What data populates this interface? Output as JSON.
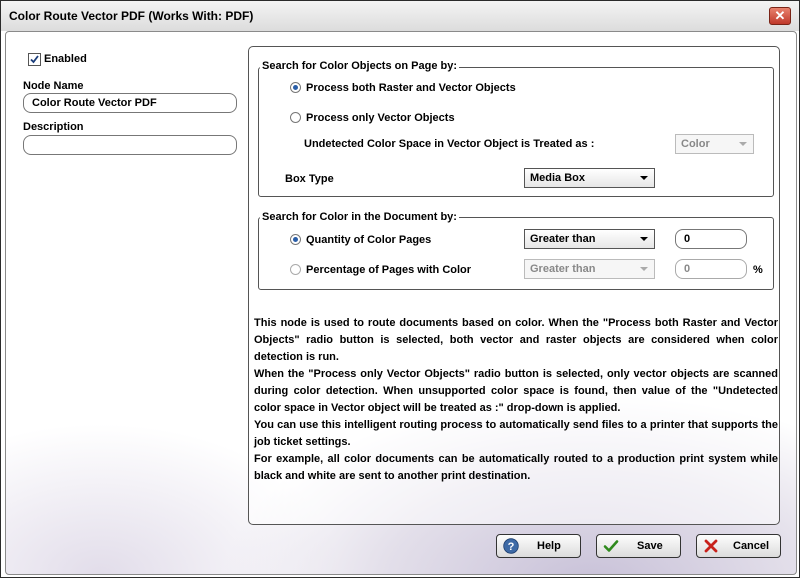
{
  "window": {
    "title": "Color Route Vector PDF  (Works With: PDF)",
    "close_label": "✕"
  },
  "left": {
    "enabled_label": "Enabled",
    "enabled_checked": true,
    "node_name_label": "Node Name",
    "node_name_value": "Color Route Vector PDF",
    "description_label": "Description",
    "description_value": ""
  },
  "objects_group": {
    "legend": "Search for Color Objects on Page by:",
    "option_both": "Process both Raster and Vector Objects",
    "option_vector": "Process only Vector Objects",
    "selected": "both",
    "undetected_label": "Undetected Color Space in Vector Object is Treated as :",
    "undetected_value": "Color",
    "box_type_label": "Box Type",
    "box_type_value": "Media Box"
  },
  "document_group": {
    "legend": "Search for Color in the Document by:",
    "quantity_label": "Quantity of Color Pages",
    "quantity_operator": "Greater than",
    "quantity_value": "0",
    "percentage_label": "Percentage of Pages with Color",
    "percentage_operator": "Greater than",
    "percentage_value": "0",
    "percent_sign": "%",
    "selected": "quantity"
  },
  "description_text": {
    "p1": "This node is used to route documents based on color. When the \"Process both Raster and Vector Objects\" radio button is selected, both vector and raster objects are considered when color detection is run.",
    "p2": "When the \"Process only Vector Objects\" radio button is selected, only vector objects are scanned during color detection. When unsupported color space is found, then value of the \"Undetected color space in Vector object will be treated as :\"  drop-down is applied.",
    "p3": "You can use this intelligent routing process to automatically send files to a printer that supports the job ticket settings.",
    "p4": "For example, all color documents can be automatically routed to a production print system while black and white are sent to another print destination."
  },
  "buttons": {
    "help": "Help",
    "save": "Save",
    "cancel": "Cancel"
  },
  "icons": {
    "help": "help-icon",
    "save": "checkmark-icon",
    "cancel": "x-icon",
    "close": "close-icon"
  },
  "colors": {
    "accent": "#2a5ea8",
    "close_button": "#c0392b",
    "save_check": "#2f8a1d",
    "cancel_x": "#c8211b"
  }
}
